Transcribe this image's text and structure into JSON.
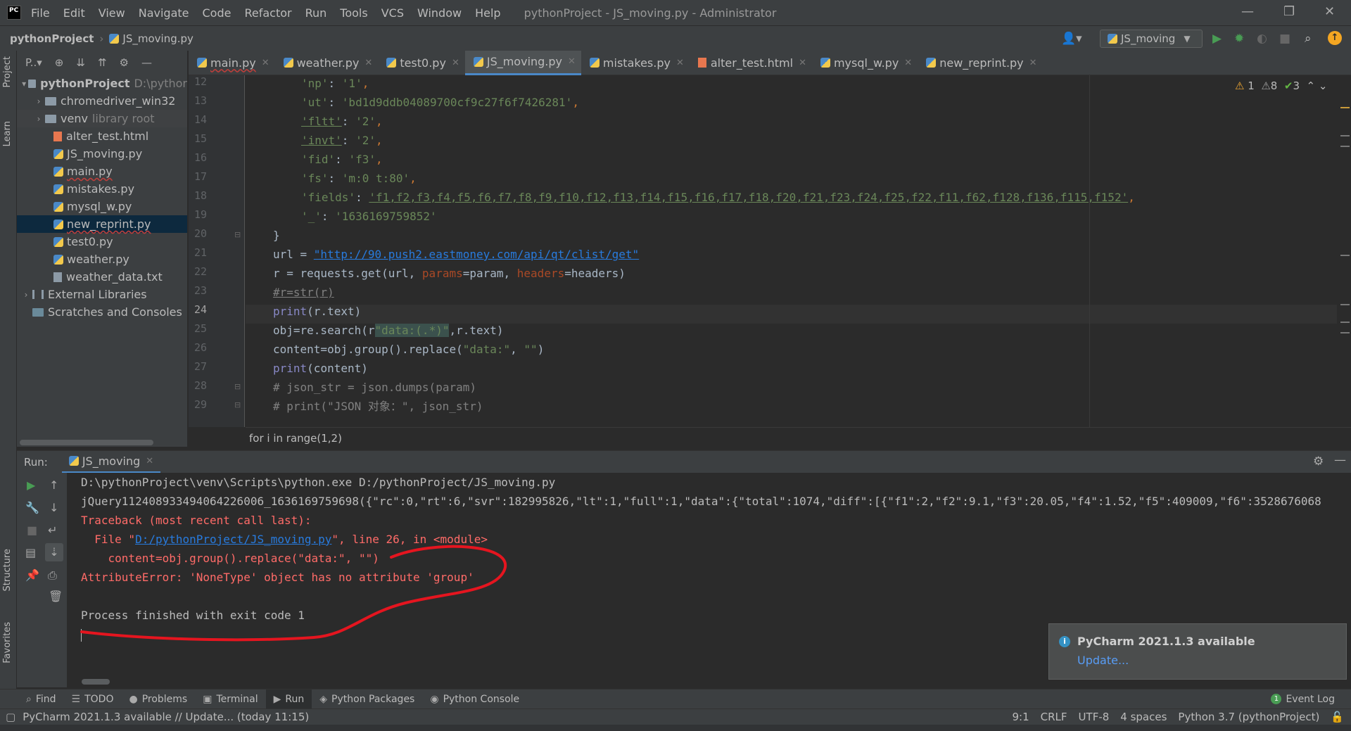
{
  "titlebar": {
    "menu": [
      "File",
      "Edit",
      "View",
      "Navigate",
      "Code",
      "Refactor",
      "Run",
      "Tools",
      "VCS",
      "Window",
      "Help"
    ],
    "window_title": "pythonProject - JS_moving.py - Administrator"
  },
  "navbar": {
    "project": "pythonProject",
    "file": "JS_moving.py",
    "run_config": "JS_moving"
  },
  "left_strip": {
    "project": "Project",
    "learn": "Learn",
    "structure": "Structure",
    "favorites": "Favorites"
  },
  "project_panel": {
    "toolbar_label": "P..▾",
    "root_name": "pythonProject",
    "root_path": "D:\\pythor",
    "items": [
      {
        "label": "chromedriver_win32",
        "kind": "folder"
      },
      {
        "label": "venv",
        "kind": "folder",
        "note": "library root"
      },
      {
        "label": "alter_test.html",
        "kind": "html"
      },
      {
        "label": "JS_moving.py",
        "kind": "py"
      },
      {
        "label": "main.py",
        "kind": "py"
      },
      {
        "label": "mistakes.py",
        "kind": "py"
      },
      {
        "label": "mysql_w.py",
        "kind": "py"
      },
      {
        "label": "new_reprint.py",
        "kind": "py"
      },
      {
        "label": "test0.py",
        "kind": "py"
      },
      {
        "label": "weather.py",
        "kind": "py"
      },
      {
        "label": "weather_data.txt",
        "kind": "txt"
      }
    ],
    "external_libraries": "External Libraries",
    "scratches": "Scratches and Consoles"
  },
  "editor_tabs": [
    "main.py",
    "weather.py",
    "test0.py",
    "JS_moving.py",
    "mistakes.py",
    "alter_test.html",
    "mysql_w.py",
    "new_reprint.py"
  ],
  "active_tab": "JS_moving.py",
  "inspections": {
    "warnings": "1",
    "weak_warnings": "8",
    "typos": "3"
  },
  "line_numbers": [
    "12",
    "13",
    "14",
    "15",
    "16",
    "17",
    "18",
    "19",
    "20",
    "21",
    "22",
    "23",
    "24",
    "25",
    "26",
    "27",
    "28",
    "29"
  ],
  "code": {
    "l12_key": "'np'",
    "l12_val": "'1'",
    "l13_key": "'ut'",
    "l13_val": "'bd1d9ddb04089700cf9c27f6f7426281'",
    "l14_key": "'fltt'",
    "l14_val": "'2'",
    "l15_key": "'invt'",
    "l15_val": "'2'",
    "l16_key": "'fid'",
    "l16_val": "'f3'",
    "l17_key": "'fs'",
    "l17_val": "'m:0 t:80'",
    "l18_key": "'fields'",
    "l18_val": "'f1,f2,f3,f4,f5,f6,f7,f8,f9,f10,f12,f13,f14,f15,f16,f17,f18,f20,f21,f23,f24,f25,f22,f11,f62,f128,f136,f115,f152'",
    "l19_key": "'_'",
    "l19_val": "'1636169759852'",
    "l20": "}",
    "l21_pre": "url = ",
    "l21_url": "\"http://90.push2.eastmoney.com/api/qt/clist/get\"",
    "l22_a": "r = requests.get(url, ",
    "l22_p1": "params",
    "l22_b": "=param, ",
    "l22_p2": "headers",
    "l22_c": "=headers)",
    "l23": "#r=str(r)",
    "l24_fn": "print",
    "l24_rest": "(r.text)",
    "l25_a": "obj=re.search(r",
    "l25_str": "\"data:(.*)\"",
    "l25_b": ",r.text)",
    "l26_a": "content=obj.group().replace(",
    "l26_s1": "\"data:\"",
    "l26_b": ", ",
    "l26_s2": "\"\"",
    "l26_c": ")",
    "l27_fn": "print",
    "l27_rest": "(content)",
    "l28": "# json_str = json.dumps(param)",
    "l29": "# print(\"JSON 对象：\", json_str)"
  },
  "editor_breadcrumb": "for i in range(1,2)",
  "run_panel": {
    "label": "Run:",
    "tab": "JS_moving",
    "console": [
      "D:\\pythonProject\\venv\\Scripts\\python.exe D:/pythonProject/JS_moving.py",
      "jQuery112408933494064226006_1636169759698({\"rc\":0,\"rt\":6,\"svr\":182995826,\"lt\":1,\"full\":1,\"data\":{\"total\":1074,\"diff\":[{\"f1\":2,\"f2\":9.1,\"f3\":20.05,\"f4\":1.52,\"f5\":409009,\"f6\":3528676068",
      "Traceback (most recent call last):",
      "  File \"",
      "D:/pythonProject/JS_moving.py",
      "\", line 26, in <module>",
      "    content=obj.group().replace(\"data:\", \"\")",
      "AttributeError: 'NoneType' object has no attribute 'group'",
      "Process finished with exit code 1"
    ]
  },
  "notification": {
    "title": "PyCharm 2021.1.3 available",
    "link": "Update..."
  },
  "tool_windows": [
    "Find",
    "TODO",
    "Problems",
    "Terminal",
    "Run",
    "Python Packages",
    "Python Console"
  ],
  "event_log": "Event Log",
  "status": {
    "message": "PyCharm 2021.1.3 available // Update... (today 11:15)",
    "position": "9:1",
    "line_sep": "CRLF",
    "encoding": "UTF-8",
    "indent": "4 spaces",
    "interpreter": "Python 3.7 (pythonProject)"
  },
  "colors": {
    "accent": "#4a88c7",
    "error": "#ff6b68",
    "string": "#6a8759",
    "keyword": "#cc7832",
    "annotation_red": "#e5151f"
  }
}
